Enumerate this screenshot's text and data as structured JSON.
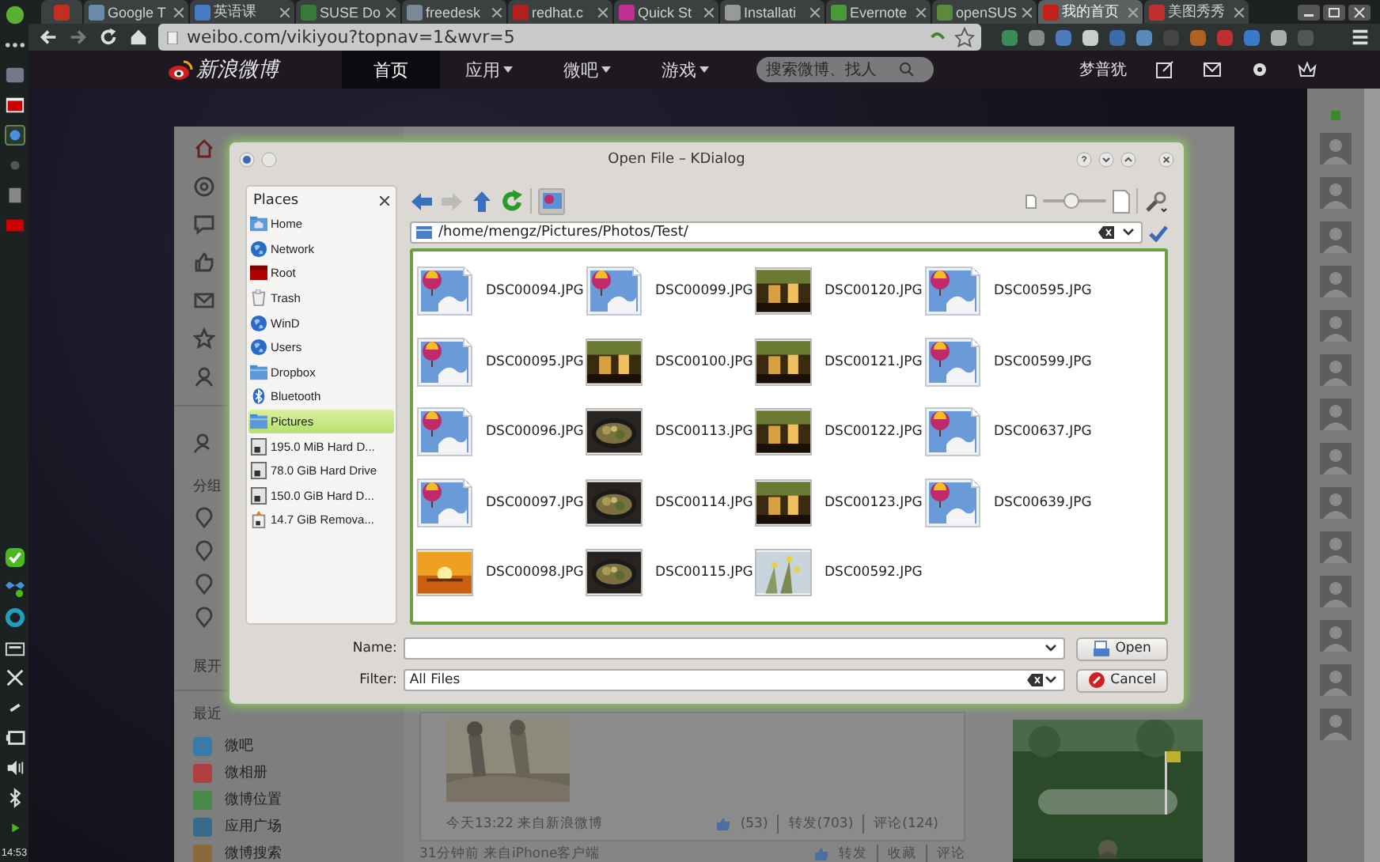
{
  "dock": {
    "clock": "14:53"
  },
  "browser": {
    "tabs": [
      {
        "label": "Google T",
        "selected": false
      },
      {
        "label": "英语课",
        "selected": false
      },
      {
        "label": "SUSE Do",
        "selected": false
      },
      {
        "label": "freedesk",
        "selected": false
      },
      {
        "label": "redhat.c",
        "selected": false
      },
      {
        "label": "Quick St",
        "selected": false
      },
      {
        "label": "Installati",
        "selected": false
      },
      {
        "label": "Evernote",
        "selected": false
      },
      {
        "label": "openSUS",
        "selected": false
      },
      {
        "label": "我的首页",
        "selected": true
      },
      {
        "label": "美图秀秀",
        "selected": false
      }
    ],
    "url": "weibo.com/vikiyou?topnav=1&wvr=5"
  },
  "weibo": {
    "logo": "新浪微博",
    "nav": [
      {
        "label": "首页",
        "selected": true
      },
      {
        "label": "应用",
        "selected": false,
        "menu": true
      },
      {
        "label": "微吧",
        "selected": false,
        "menu": true
      },
      {
        "label": "游戏",
        "selected": false,
        "menu": true
      }
    ],
    "search": {
      "placeholder": "搜索微博、找人"
    },
    "user": "梦普犹",
    "sidebar": {
      "group_heading": "分组",
      "expand": "展开",
      "recent_heading": "最近",
      "apps": [
        "微吧",
        "微相册",
        "微博位置",
        "应用广场",
        "微博搜索"
      ]
    },
    "posts": [
      {
        "meta": "今天13:22  来自新浪微博",
        "actions": [
          "(53)",
          "转发(703)",
          "评论(124)"
        ],
        "picture": true
      },
      {
        "meta": "31分钟前  来自iPhone客户端",
        "actions": [
          "转发",
          "收藏",
          "评论"
        ]
      }
    ]
  },
  "dialog": {
    "title": "Open File – KDialog",
    "places": {
      "title": "Places",
      "items": [
        {
          "label": "Home",
          "kind": "home",
          "selected": false
        },
        {
          "label": "Network",
          "kind": "network",
          "selected": false
        },
        {
          "label": "Root",
          "kind": "root",
          "selected": false
        },
        {
          "label": "Trash",
          "kind": "trash",
          "selected": false
        },
        {
          "label": "WinD",
          "kind": "network",
          "selected": false
        },
        {
          "label": "Users",
          "kind": "network",
          "selected": false
        },
        {
          "label": "Dropbox",
          "kind": "folder",
          "selected": false
        },
        {
          "label": "Bluetooth",
          "kind": "bluetooth",
          "selected": false
        },
        {
          "label": "Pictures",
          "kind": "folder",
          "selected": true
        },
        {
          "label": "195.0 MiB Hard D...",
          "kind": "drive",
          "selected": false
        },
        {
          "label": "78.0 GiB Hard Drive",
          "kind": "drive",
          "selected": false
        },
        {
          "label": "150.0 GiB Hard D...",
          "kind": "drive",
          "selected": false
        },
        {
          "label": "14.7 GiB Remova...",
          "kind": "removable",
          "selected": false
        }
      ]
    },
    "zoom": {
      "level": 0.45
    },
    "path": "/home/mengz/Pictures/Photos/Test/",
    "files": [
      {
        "name": "DSC00094.JPG",
        "kind": "icon"
      },
      {
        "name": "DSC00099.JPG",
        "kind": "icon"
      },
      {
        "name": "DSC00120.JPG",
        "kind": "picture"
      },
      {
        "name": "DSC00595.JPG",
        "kind": "icon"
      },
      {
        "name": "DSC00095.JPG",
        "kind": "icon"
      },
      {
        "name": "DSC00100.JPG",
        "kind": "picture"
      },
      {
        "name": "DSC00121.JPG",
        "kind": "picture"
      },
      {
        "name": "DSC00599.JPG",
        "kind": "icon"
      },
      {
        "name": "DSC00096.JPG",
        "kind": "icon"
      },
      {
        "name": "DSC00113.JPG",
        "kind": "picture"
      },
      {
        "name": "DSC00122.JPG",
        "kind": "picture"
      },
      {
        "name": "DSC00637.JPG",
        "kind": "icon"
      },
      {
        "name": "DSC00097.JPG",
        "kind": "icon"
      },
      {
        "name": "DSC00114.JPG",
        "kind": "picture"
      },
      {
        "name": "DSC00123.JPG",
        "kind": "picture"
      },
      {
        "name": "DSC00639.JPG",
        "kind": "icon"
      },
      {
        "name": "DSC00098.JPG",
        "kind": "picture"
      },
      {
        "name": "DSC00115.JPG",
        "kind": "picture"
      },
      {
        "name": "DSC00592.JPG",
        "kind": "picture"
      }
    ],
    "name_label": "Name:",
    "filter_label": "Filter:",
    "filter": "All Files",
    "buttons": [
      "Open",
      "Cancel"
    ]
  }
}
